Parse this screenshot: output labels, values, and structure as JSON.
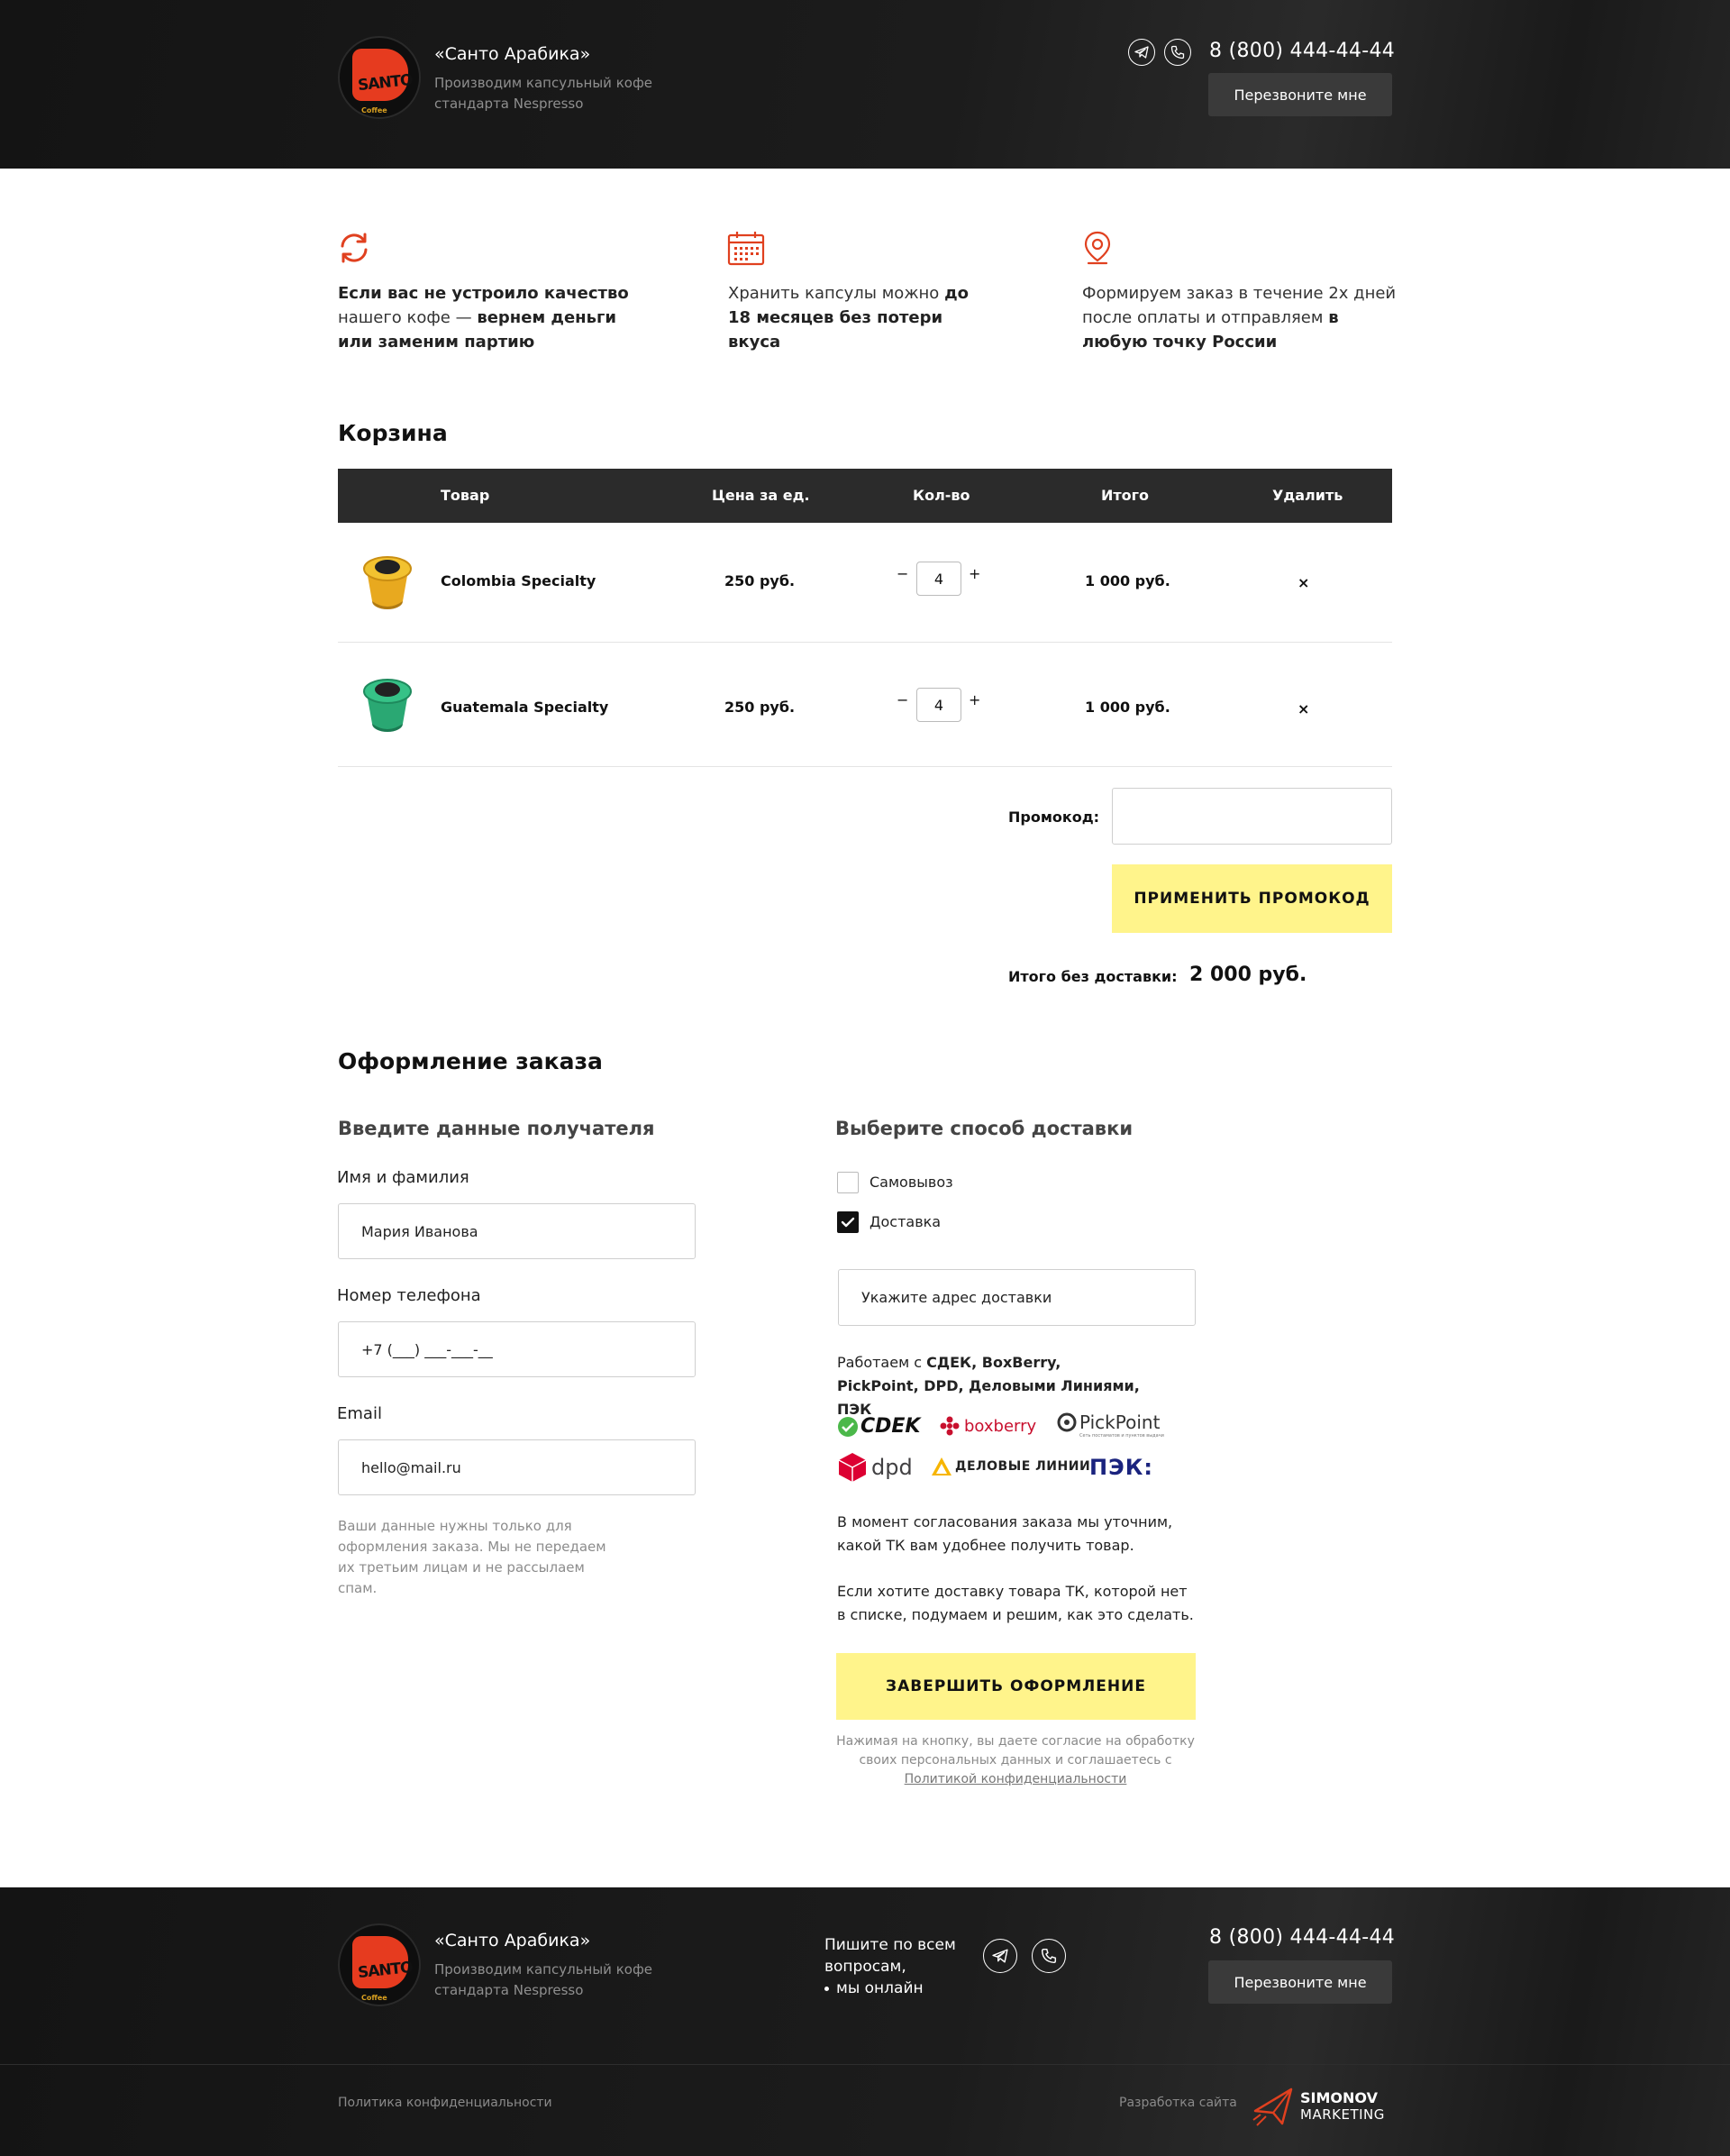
{
  "header": {
    "brand_name": "«Санто Арабика»",
    "brand_sub": "Производим капсульный кофе стандарта Nespresso",
    "logo_text": "SANTO",
    "logo_sub": "Coffee",
    "phone": "8 (800) 444-44-44",
    "callback": "Перезвоните мне"
  },
  "features": [
    {
      "icon": "refresh-icon",
      "pre": "Если вас не устроило качество",
      "mid": " нашего кофе — ",
      "bold": "вернем деньги или заменим партию"
    },
    {
      "icon": "calendar-icon",
      "pre": "Хранить капсулы можно",
      "bold": "до 18 месяцев без потери вкуса"
    },
    {
      "icon": "location-pin-icon",
      "pre": "Формируем заказ в течение 2х дней после оплаты и отправляем",
      "bold": "в любую точку России"
    }
  ],
  "cart": {
    "title": "Корзина",
    "columns": [
      "Товар",
      "Цена за ед.",
      "Кол-во",
      "Итого",
      "Удалить"
    ],
    "items": [
      {
        "name": "Colombia Specialty",
        "price": "250 руб.",
        "qty": "4",
        "total": "1 000 руб.",
        "color": "#e8a91f"
      },
      {
        "name": "Guatemala Specialty",
        "price": "250 руб.",
        "qty": "4",
        "total": "1 000 руб.",
        "color": "#2aa873"
      }
    ],
    "promo_label": "Промокод:",
    "promo_button": "ПРИМЕНИТЬ ПРОМОКОД",
    "total_label": "Итого без доставки:",
    "total_value": "2 000 руб."
  },
  "checkout": {
    "title": "Оформление заказа",
    "recipient_title": "Введите данные получателя",
    "name_label": "Имя и фамилия",
    "name_value": "Мария Иванова",
    "phone_label": "Номер телефона",
    "phone_value": "+7 (___) ___-___-__",
    "email_label": "Email",
    "email_value": "hello@mail.ru",
    "privacy_note": "Ваши данные нужны только для оформления заказа. Мы не передаем их третьим лицам и не рассылаем спам.",
    "delivery_title": "Выберите способ доставки",
    "option_pickup": "Самовывоз",
    "option_delivery": "Доставка",
    "address_placeholder": "Укажите адрес доставки",
    "carriers_prefix": "Работаем с ",
    "carriers_list": "СДЕК, BoxBerry, PickPoint, DPD, Деловыми Линиями, ПЭК",
    "carrier_logos": [
      "CDEK",
      "boxberry",
      "PickPoint",
      "dpd",
      "ДЕЛОВЫЕ ЛИНИИ",
      "ПЭК:"
    ],
    "pickpoint_tag": "Сеть постаматов и пунктов выдачи",
    "info1": "В момент согласования заказа мы уточним, какой ТК вам удобнее получить товар.",
    "info2": "Если хотите доставку товара ТК, которой нет в списке, подумаем и решим, как это сделать.",
    "submit": "ЗАВЕРШИТЬ ОФОРМЛЕНИЕ",
    "legal_pre": "Нажимая на кнопку, вы даете согласие на обработку своих персональных данных и соглашаетесь с ",
    "legal_link": "Политикой конфиденциальности"
  },
  "footer": {
    "brand_name": "«Санто Арабика»",
    "brand_sub": "Производим капсульный кофе стандарта Nespresso",
    "write_us": "Пишите по всем вопросам,",
    "online": "мы онлайн",
    "phone": "8 (800) 444-44-44",
    "callback": "Перезвоните мне",
    "policy": "Политика конфиденциальности",
    "dev_label": "Разработка сайта",
    "dev_name": "SIMONOV",
    "dev_name2": "MARKETING"
  },
  "colors": {
    "accent_yellow": "#fff48b",
    "accent_red": "#e0303a",
    "dark_bg": "#1c1c1c"
  }
}
